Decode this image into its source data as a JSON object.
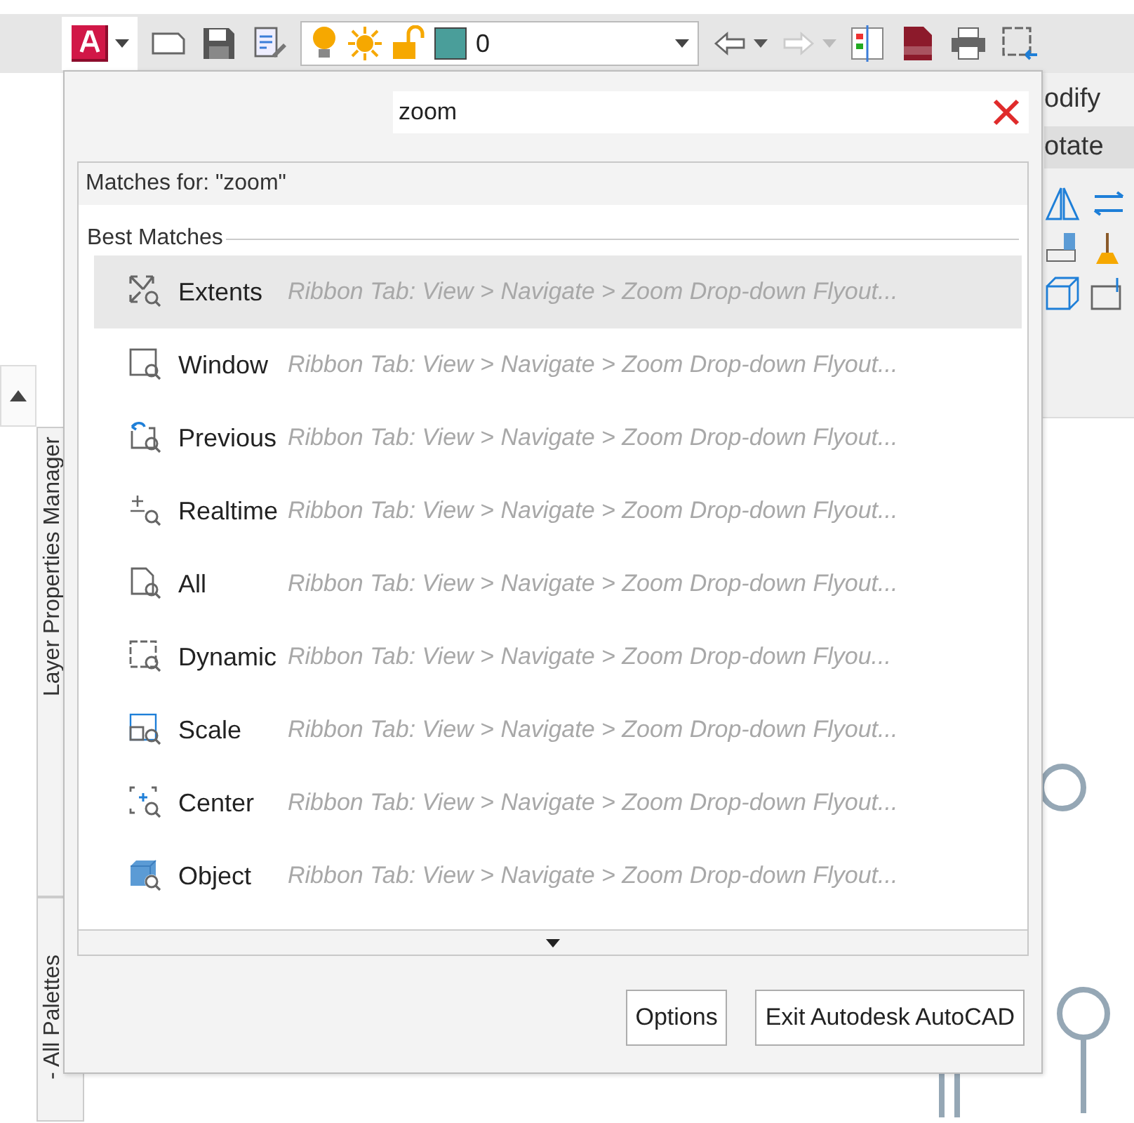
{
  "toolbar": {
    "buttons": [
      {
        "kind": "app"
      },
      {
        "kind": "new"
      },
      {
        "kind": "save"
      },
      {
        "kind": "saveas"
      }
    ],
    "layer": {
      "name": "0",
      "color": "#4a9e9a"
    },
    "history": [
      {
        "kind": "undo",
        "disabled": false
      },
      {
        "kind": "redo",
        "disabled": true
      }
    ],
    "tools": [
      {
        "kind": "sheets"
      },
      {
        "kind": "dwf"
      },
      {
        "kind": "print"
      },
      {
        "kind": "window"
      }
    ]
  },
  "ribbon": {
    "tab": "odify",
    "command": "otate"
  },
  "palettes": [
    "Layer Properties Manager",
    "- All Palettes"
  ],
  "search_menu": {
    "query": "zoom",
    "matches_header": "Matches for: \"zoom\"",
    "section": "Best Matches",
    "results": [
      {
        "kind": "extents",
        "label": "Extents",
        "path": "Ribbon Tab: View > Navigate > Zoom Drop-down Flyout...",
        "selected": true
      },
      {
        "kind": "window",
        "label": "Window",
        "path": "Ribbon Tab: View > Navigate > Zoom Drop-down Flyout...",
        "selected": false
      },
      {
        "kind": "previous",
        "label": "Previous",
        "path": "Ribbon Tab: View > Navigate > Zoom Drop-down Flyout...",
        "selected": false
      },
      {
        "kind": "realtime",
        "label": "Realtime",
        "path": "Ribbon Tab: View > Navigate > Zoom Drop-down Flyout...",
        "selected": false
      },
      {
        "kind": "all",
        "label": "All",
        "path": "Ribbon Tab: View > Navigate > Zoom Drop-down Flyout...",
        "selected": false
      },
      {
        "kind": "dynamic",
        "label": "Dynamic",
        "path": "Ribbon Tab: View > Navigate > Zoom Drop-down Flyou...",
        "selected": false
      },
      {
        "kind": "scale",
        "label": "Scale",
        "path": "Ribbon Tab: View > Navigate > Zoom Drop-down Flyout...",
        "selected": false
      },
      {
        "kind": "center",
        "label": "Center",
        "path": "Ribbon Tab: View > Navigate > Zoom Drop-down Flyout...",
        "selected": false
      },
      {
        "kind": "object",
        "label": "Object",
        "path": "Ribbon Tab: View > Navigate > Zoom Drop-down Flyout...",
        "selected": false
      }
    ],
    "buttons": [
      "Options",
      "Exit Autodesk AutoCAD"
    ]
  }
}
